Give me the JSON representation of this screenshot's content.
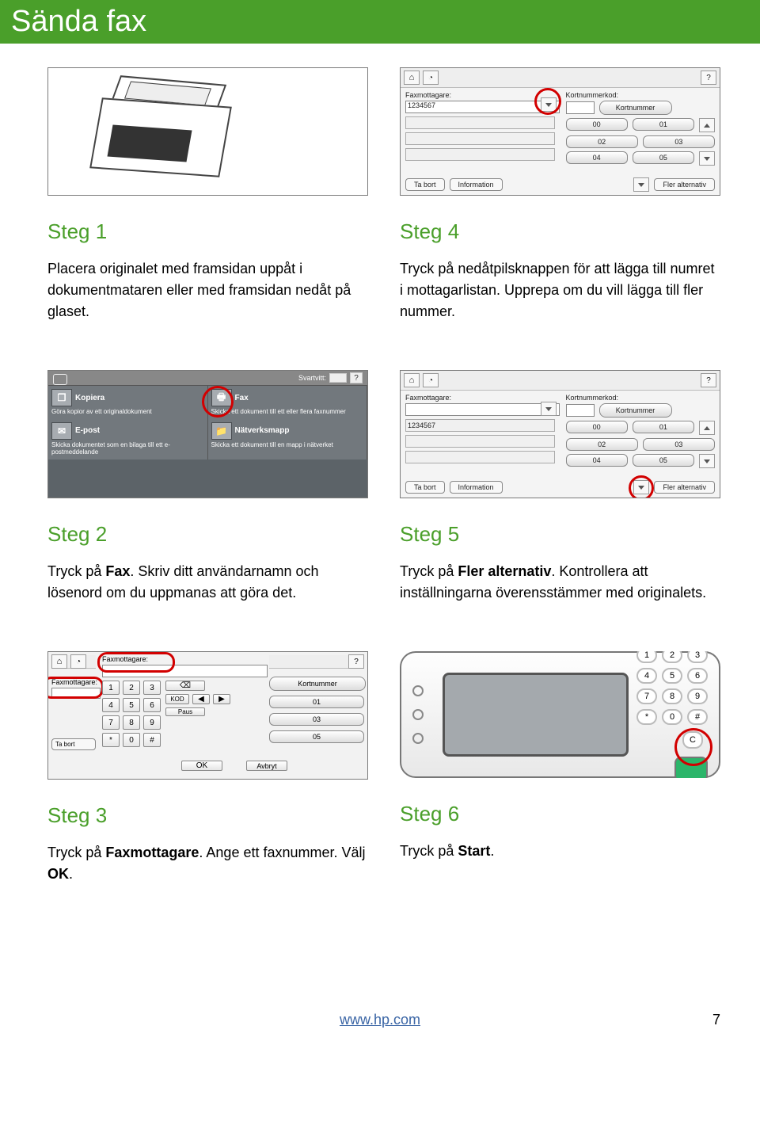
{
  "title": "Sända fax",
  "footer": {
    "link": "www.hp.com",
    "page": "7"
  },
  "step1": {
    "title": "Steg 1",
    "body": "Placera originalet med framsidan uppåt i dokumentmataren eller med framsidan nedåt på glaset."
  },
  "step4": {
    "title": "Steg 4",
    "body": "Tryck på nedåtpilsknappen för att lägga till numret i mottagarlistan. Upprepa om du vill lägga till fler nummer.",
    "panel": {
      "left_label": "Faxmottagare:",
      "left_value": "1234567",
      "right_label": "Kortnummerkod:",
      "right_button": "Kortnummer",
      "codes": [
        "00",
        "01",
        "02",
        "03",
        "04",
        "05"
      ],
      "remove": "Ta bort",
      "info": "Information",
      "more": "Fler alternativ"
    }
  },
  "step2": {
    "title": "Steg 2",
    "body_pre": "Tryck på ",
    "body_b1": "Fax",
    "body_mid": ". Skriv ditt användarnamn och lösenord om du uppmanas att göra det.",
    "panel": {
      "bw": "Svartvitt:",
      "cards": {
        "copy": {
          "title": "Kopiera",
          "sub": "Göra kopior av ett originaldokument"
        },
        "fax": {
          "title": "Fax",
          "sub": "Skicka ett dokument till ett eller flera faxnummer"
        },
        "email": {
          "title": "E-post",
          "sub": "Skicka dokumentet som en bilaga till ett e-postmeddelande"
        },
        "netfolder": {
          "title": "Nätverksmapp",
          "sub": "Skicka ett dokument till en mapp i nätverket"
        }
      }
    }
  },
  "step5": {
    "title": "Steg 5",
    "body_pre": "Tryck på ",
    "body_b1": "Fler alternativ",
    "body_post": ". Kontrollera att inställningarna överensstämmer med originalets.",
    "panel": {
      "left_label": "Faxmottagare:",
      "list_value": "1234567",
      "right_label": "Kortnummerkod:",
      "right_button": "Kortnummer",
      "codes": [
        "00",
        "01",
        "02",
        "03",
        "04",
        "05"
      ],
      "remove": "Ta bort",
      "info": "Information",
      "more": "Fler alternativ"
    }
  },
  "step3": {
    "title": "Steg 3",
    "body_pre": "Tryck på ",
    "body_b1": "Faxmottagare",
    "body_mid": ". Ange ett faxnummer. Välj ",
    "body_b2": "OK",
    "body_post": ".",
    "panel": {
      "header": "Faxmottagare:",
      "left_label": "Faxmottagare:",
      "right_button": "Kortnummer",
      "codes": [
        "01",
        "03",
        "05"
      ],
      "keys": [
        "1",
        "2",
        "3",
        "4",
        "5",
        "6",
        "7",
        "8",
        "9",
        "*",
        "0",
        "#"
      ],
      "kod": "KOD",
      "paus": "Paus",
      "ok": "OK",
      "cancel": "Avbryt",
      "remove": "Ta bort"
    }
  },
  "step6": {
    "title": "Steg 6",
    "body_pre": "Tryck på ",
    "body_b1": "Start",
    "body_post": ".",
    "panel": {
      "keys": [
        "1",
        "2",
        "3",
        "4",
        "5",
        "6",
        "7",
        "8",
        "9",
        "*",
        "0",
        "#"
      ],
      "clear": "C"
    }
  }
}
